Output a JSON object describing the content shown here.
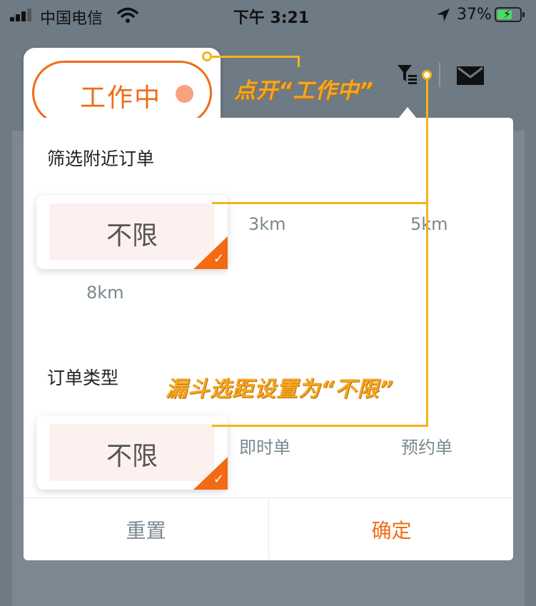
{
  "status_bar": {
    "carrier": "中国电信",
    "time": "下午 3:21",
    "battery_percent": "37%",
    "battery_level": 0.37
  },
  "header": {
    "work_status_label": "工作中",
    "icons": [
      "filter-icon",
      "mail-icon"
    ]
  },
  "filter": {
    "distance_title": "筛选附近订单",
    "distance_options": [
      "不限",
      "3km",
      "5km",
      "8km"
    ],
    "distance_selected": "不限",
    "type_title": "订单类型",
    "type_options": [
      "不限",
      "即时单",
      "预约单"
    ],
    "type_selected": "不限",
    "reset_label": "重置",
    "confirm_label": "确定"
  },
  "annotations": {
    "tip1": "点开“工作中”",
    "tip2": "漏斗选距设置为“不限”"
  },
  "colors": {
    "accent": "#ef6c18",
    "annotation": "#f4b41a",
    "selected_bg": "#fdf1f0",
    "overlay": "#6e7a84"
  }
}
